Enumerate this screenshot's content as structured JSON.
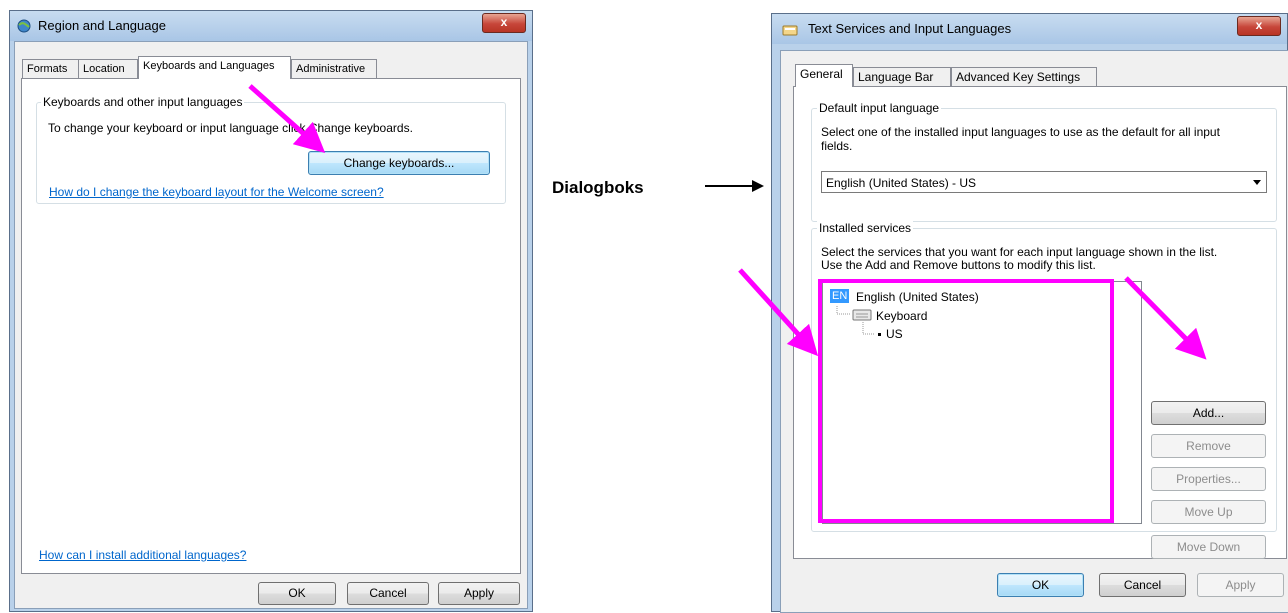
{
  "region_window": {
    "title": "Region and Language",
    "close_label": "x",
    "tabs": [
      {
        "label": "Formats"
      },
      {
        "label": "Location"
      },
      {
        "label": "Keyboards and Languages"
      },
      {
        "label": "Administrative"
      }
    ],
    "group_title": "Keyboards and other input languages",
    "description": "To change your keyboard or input language click Change keyboards.",
    "change_keyboards_label": "Change keyboards...",
    "welcome_link": "How do I change the keyboard layout for the Welcome screen?",
    "install_link": "How can I install additional languages?",
    "ok_label": "OK",
    "cancel_label": "Cancel",
    "apply_label": "Apply"
  },
  "annotation": {
    "label": "Dialogboks",
    "highlight_color": "#ff00ff"
  },
  "text_services_window": {
    "title": "Text Services and Input Languages",
    "close_label": "x",
    "tabs": [
      {
        "label": "General"
      },
      {
        "label": "Language Bar"
      },
      {
        "label": "Advanced Key Settings"
      }
    ],
    "default_group_title": "Default input language",
    "default_desc_line1": "Select one of the installed input languages to use as the default for all input",
    "default_desc_line2": "fields.",
    "default_selected": "English (United States) - US",
    "installed_group_title": "Installed services",
    "installed_desc_line1": "Select the services that you want for each input language shown in the list.",
    "installed_desc_line2": "Use the Add and Remove buttons to modify this list.",
    "tree": {
      "language_badge": "EN",
      "language": "English (United States)",
      "category": "Keyboard",
      "layout": "US"
    },
    "buttons": {
      "add": "Add...",
      "remove": "Remove",
      "properties": "Properties...",
      "move_up": "Move Up",
      "move_down": "Move Down"
    },
    "ok_label": "OK",
    "cancel_label": "Cancel",
    "apply_label": "Apply"
  }
}
